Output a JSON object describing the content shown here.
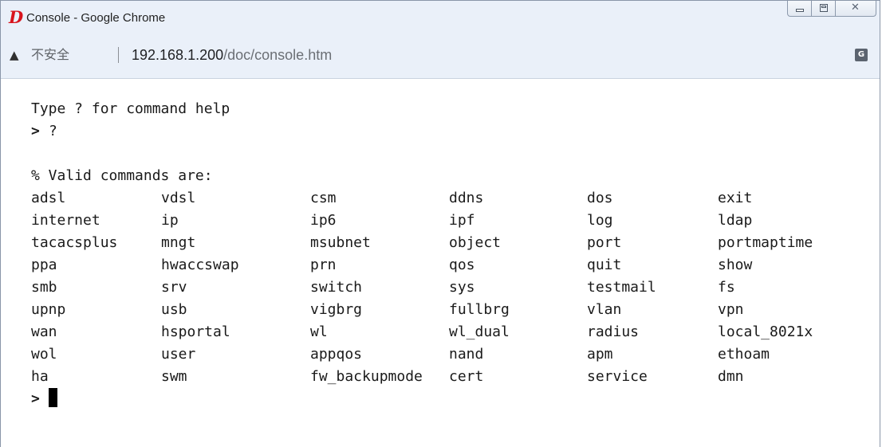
{
  "window": {
    "title": "Console - Google Chrome",
    "app_icon_glyph": "D",
    "controls": {
      "minimize": "minimize",
      "maximize": "maximize",
      "close": "✕"
    }
  },
  "address_bar": {
    "security_label": "不安全",
    "url_host": "192.168.1.200",
    "url_path": "/doc/console.htm",
    "warning_icon": "▲",
    "translate_icon": "G"
  },
  "console": {
    "intro": "Type ? for command help",
    "prompt_mark": ">",
    "first_input": "?",
    "header": "% Valid commands are:",
    "commands": [
      [
        "adsl",
        "vdsl",
        "csm",
        "ddns",
        "dos",
        "exit"
      ],
      [
        "internet",
        "ip",
        "ip6",
        "ipf",
        "log",
        "ldap"
      ],
      [
        "tacacsplus",
        "mngt",
        "msubnet",
        "object",
        "port",
        "portmaptime"
      ],
      [
        "ppa",
        "hwaccswap",
        "prn",
        "qos",
        "quit",
        "show"
      ],
      [
        "smb",
        "srv",
        "switch",
        "sys",
        "testmail",
        "fs"
      ],
      [
        "upnp",
        "usb",
        "vigbrg",
        "fullbrg",
        "vlan",
        "vpn"
      ],
      [
        "wan",
        "hsportal",
        "wl",
        "wl_dual",
        "radius",
        "local_8021x"
      ],
      [
        "wol",
        "user",
        "appqos",
        "nand",
        "apm",
        "ethoam"
      ],
      [
        "ha",
        "swm",
        "fw_backupmode",
        "cert",
        "service",
        "dmn"
      ]
    ]
  }
}
